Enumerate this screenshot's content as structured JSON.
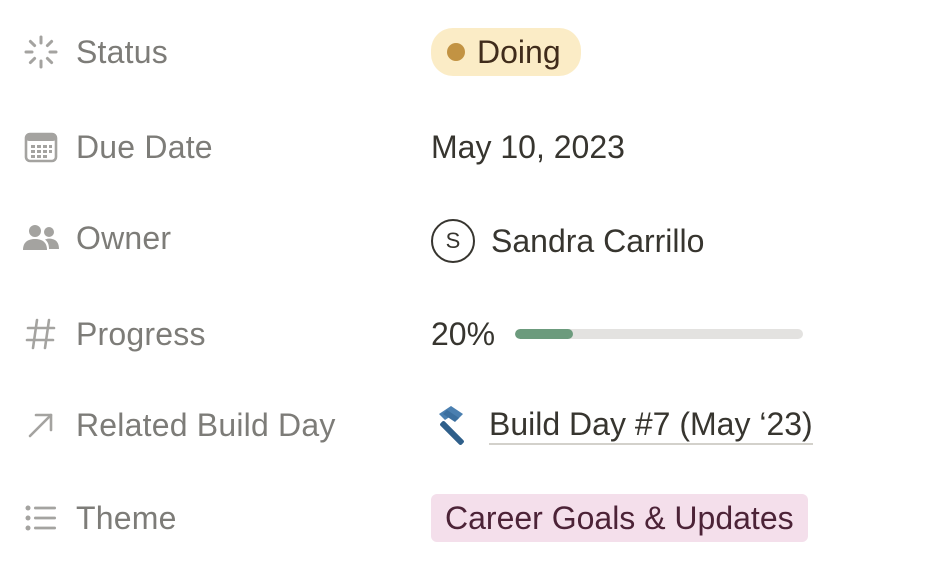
{
  "properties": {
    "status": {
      "label": "Status",
      "icon": "status-spinner-icon",
      "value": "Doing",
      "pill_bg": "#fbecc6",
      "dot_color": "#c29343"
    },
    "due_date": {
      "label": "Due Date",
      "icon": "calendar-icon",
      "value": "May 10, 2023"
    },
    "owner": {
      "label": "Owner",
      "icon": "people-icon",
      "avatar_initial": "S",
      "value": "Sandra Carrillo"
    },
    "progress": {
      "label": "Progress",
      "icon": "hash-icon",
      "value": "20%",
      "fraction": 0.2,
      "fill_color": "#6c9b7d"
    },
    "related_build_day": {
      "label": "Related Build Day",
      "icon": "arrow-up-right-icon",
      "emoji_icon": "hammer-icon",
      "value": "Build Day #7 (May ‘23)"
    },
    "theme": {
      "label": "Theme",
      "icon": "list-icon",
      "value": "Career Goals & Updates",
      "tag_bg": "#f4dfeb",
      "tag_text": "#4c2337"
    }
  }
}
